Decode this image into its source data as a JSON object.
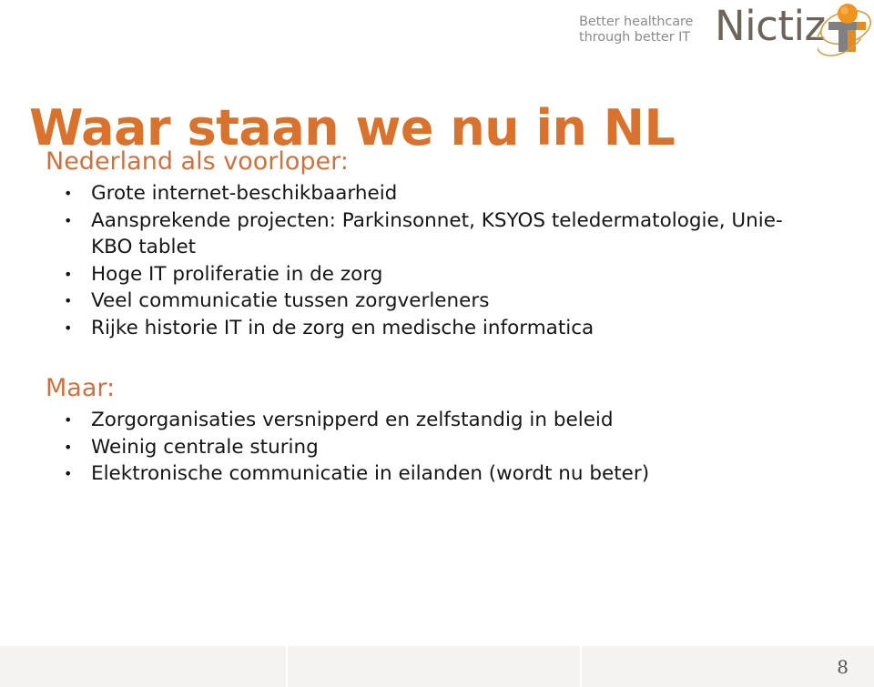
{
  "slide": {
    "title": "Waar staan we nu in NL",
    "page_number": "8",
    "title_color": "#d9722c",
    "heading_color": "#cb7340",
    "body_color": "#161616",
    "footer_color": "#f4f3f1"
  },
  "brand": {
    "tagline": "Better healthcare\nthrough better IT",
    "wordmark": "Nictiz",
    "logo_icon_name": "nictiz-t-figure-logo",
    "logo_colors": {
      "gray": "#808080",
      "orange": "#e98a1f",
      "sphere": "#f0941e",
      "ring": "#c9a24a"
    }
  },
  "content": {
    "groups": [
      {
        "heading": "Nederland als voorloper:",
        "bullets": [
          "Grote internet-beschikbaarheid",
          "Aansprekende projecten: Parkinsonnet, KSYOS teledermatologie, Unie-KBO tablet",
          "Hoge IT proliferatie in de zorg",
          "Veel communicatie tussen zorgverleners",
          "Rijke historie IT in de zorg en medische informatica"
        ]
      },
      {
        "heading": "Maar:",
        "bullets": [
          "Zorgorganisaties versnipperd en zelfstandig in beleid",
          "Weinig centrale sturing",
          "Elektronische communicatie in eilanden (wordt nu beter)"
        ]
      }
    ]
  }
}
